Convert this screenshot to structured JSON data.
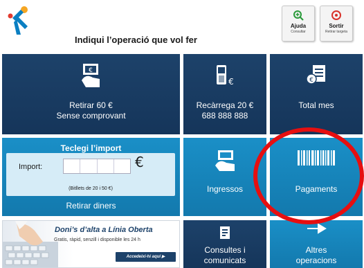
{
  "header": {
    "prompt": "Indiqui l’operació que vol fer",
    "help": {
      "label": "Ajuda",
      "sublabel": "Consultar"
    },
    "exit": {
      "label": "Sortir",
      "sublabel": "Retirar targeta"
    }
  },
  "tiles": {
    "withdraw": {
      "line1": "Retirar 60 €",
      "line2": "Sense comprovant",
      "icon": "cash-withdraw-icon"
    },
    "topup": {
      "line1": "Recàrrega 20 €",
      "line2": "688 888 888",
      "icon": "mobile-euro-icon"
    },
    "total": {
      "line1": "Total mes",
      "icon": "statement-icon"
    },
    "amount": {
      "title": "Teclegi l’import",
      "label": "Import:",
      "currency": "€",
      "note": "(Bitllets de 20 i 50 €)",
      "action": "Retirar diners"
    },
    "deposit": {
      "line1": "Ingressos",
      "icon": "deposit-card-icon"
    },
    "payments": {
      "line1": "Pagaments",
      "icon": "barcode-icon"
    },
    "queries": {
      "line1": "Consultes i",
      "line2": "comunicats",
      "icon": "document-icon"
    },
    "other": {
      "line1": "Altres",
      "line2": "operacions",
      "icon": "arrow-icon"
    }
  },
  "banner": {
    "title": "Doni’s d’alta a Línia Oberta",
    "subtitle": "Gratis, ràpid, senzill i disponible les 24 h",
    "button": "Accedeixi-hi aquí ▶"
  },
  "colors": {
    "dark_tile": "#1d426a",
    "light_tile": "#1a8fc7",
    "annotation_ring": "#e60f10",
    "logo_blue": "#0a7fc2",
    "logo_star": "#f5a623"
  }
}
